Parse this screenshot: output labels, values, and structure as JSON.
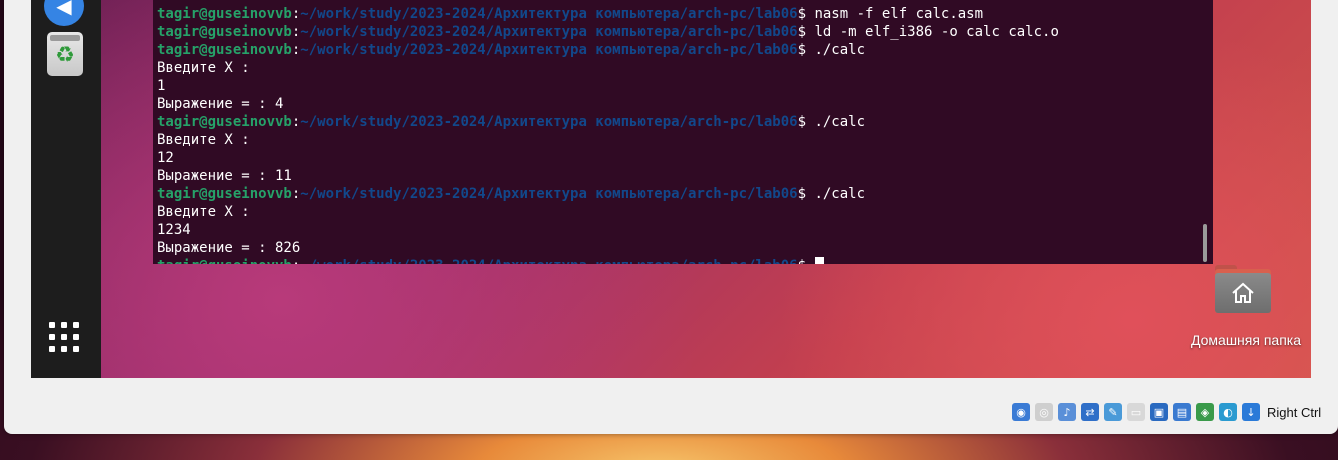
{
  "terminal": {
    "user_host": "tagir@guseinovvb",
    "colon": ":",
    "path": "~/work/study/2023-2024/Архитектура компьютера/arch-pc/lab06",
    "dollar": "$ ",
    "lines": [
      {
        "type": "output",
        "text": "."
      },
      {
        "type": "prompt",
        "cmd": "nasm -f elf calc.asm"
      },
      {
        "type": "prompt",
        "cmd": "ld -m elf_i386 -o calc calc.o"
      },
      {
        "type": "prompt",
        "cmd": "./calc"
      },
      {
        "type": "output",
        "text": "Введите X :"
      },
      {
        "type": "output",
        "text": "1"
      },
      {
        "type": "output",
        "text": "Выражение = : 4"
      },
      {
        "type": "prompt",
        "cmd": "./calc"
      },
      {
        "type": "output",
        "text": "Введите X :"
      },
      {
        "type": "output",
        "text": "12"
      },
      {
        "type": "output",
        "text": "Выражение = : 11"
      },
      {
        "type": "prompt",
        "cmd": "./calc"
      },
      {
        "type": "output",
        "text": "Введите X :"
      },
      {
        "type": "output",
        "text": "1234"
      },
      {
        "type": "output",
        "text": "Выражение = : 826"
      },
      {
        "type": "prompt",
        "cmd": "",
        "cursor": true
      }
    ]
  },
  "desktop": {
    "home_folder_label": "Домашняя папка"
  },
  "dock": {
    "icons": [
      "files-icon",
      "trash-icon",
      "show-apps-icon"
    ]
  },
  "status_bar": {
    "host_key_label": "Right Ctrl",
    "icons": [
      {
        "name": "hard-disk-icon",
        "color": "#3a7bd5",
        "glyph": "◉"
      },
      {
        "name": "optical-drive-icon",
        "color": "#cfcfcf",
        "glyph": "◎"
      },
      {
        "name": "audio-icon",
        "color": "#5a8fd8",
        "glyph": "♪"
      },
      {
        "name": "network-icon",
        "color": "#2f6fc8",
        "glyph": "⇄"
      },
      {
        "name": "usb-icon",
        "color": "#4a9ad8",
        "glyph": "✎"
      },
      {
        "name": "shared-folders-icon",
        "color": "#d8d8d8",
        "glyph": "▭"
      },
      {
        "name": "display-icon",
        "color": "#2a6ac0",
        "glyph": "▣"
      },
      {
        "name": "recording-icon",
        "color": "#3a7ad0",
        "glyph": "▤"
      },
      {
        "name": "cpu-icon",
        "color": "#3a9a4a",
        "glyph": "◈"
      },
      {
        "name": "guest-additions-icon",
        "color": "#2a9ad0",
        "glyph": "◐"
      },
      {
        "name": "mouse-integration-icon",
        "color": "#2a7ad8",
        "glyph": "↓"
      }
    ]
  }
}
